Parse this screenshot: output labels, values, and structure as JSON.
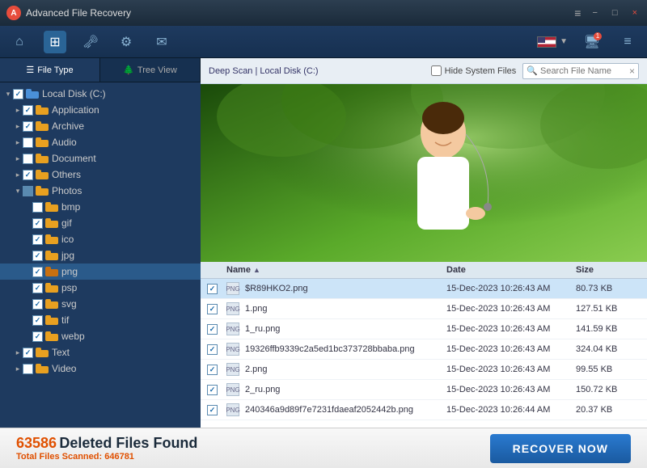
{
  "app": {
    "title": "Advanced File Recovery",
    "logo_letter": "A"
  },
  "toolbar": {
    "buttons": [
      "⌂",
      "⊞",
      "🔑",
      "⚙",
      "✉"
    ],
    "active_index": 1,
    "flag_code": "US",
    "recover_label": "RECOVER NOW"
  },
  "sidebar": {
    "tab_file_type": "File Type",
    "tab_tree_view": "Tree View",
    "active_tab": "file_type",
    "tree": {
      "root": "Local Disk (C:)",
      "items": [
        {
          "id": "application",
          "label": "Application",
          "indent": 1,
          "checked": true,
          "expanded": false
        },
        {
          "id": "archive",
          "label": "Archive",
          "indent": 1,
          "checked": true,
          "expanded": false
        },
        {
          "id": "audio",
          "label": "Audio",
          "indent": 1,
          "checked": false,
          "expanded": false
        },
        {
          "id": "document",
          "label": "Document",
          "indent": 1,
          "checked": false,
          "expanded": false
        },
        {
          "id": "others",
          "label": "Others",
          "indent": 1,
          "checked": true,
          "expanded": false
        },
        {
          "id": "photos",
          "label": "Photos",
          "indent": 1,
          "checked": true,
          "expanded": true
        },
        {
          "id": "bmp",
          "label": "bmp",
          "indent": 2,
          "checked": false,
          "expanded": false
        },
        {
          "id": "gif",
          "label": "gif",
          "indent": 2,
          "checked": true,
          "expanded": false
        },
        {
          "id": "ico",
          "label": "ico",
          "indent": 2,
          "checked": true,
          "expanded": false
        },
        {
          "id": "jpg",
          "label": "jpg",
          "indent": 2,
          "checked": true,
          "expanded": false
        },
        {
          "id": "png",
          "label": "png",
          "indent": 2,
          "checked": true,
          "expanded": false,
          "selected": true
        },
        {
          "id": "psp",
          "label": "psp",
          "indent": 2,
          "checked": true,
          "expanded": false
        },
        {
          "id": "svg",
          "label": "svg",
          "indent": 2,
          "checked": true,
          "expanded": false
        },
        {
          "id": "tif",
          "label": "tif",
          "indent": 2,
          "checked": true,
          "expanded": false
        },
        {
          "id": "webp",
          "label": "webp",
          "indent": 2,
          "checked": true,
          "expanded": false
        },
        {
          "id": "text",
          "label": "Text",
          "indent": 1,
          "checked": true,
          "expanded": false
        },
        {
          "id": "video",
          "label": "Video",
          "indent": 1,
          "checked": false,
          "expanded": false
        }
      ]
    }
  },
  "content": {
    "breadcrumb_scan": "Deep Scan",
    "breadcrumb_sep": "|",
    "breadcrumb_disk": "Local Disk (C:)",
    "hide_system_files_label": "Hide System Files",
    "search_placeholder": "Search File Name",
    "columns": {
      "name": "Name",
      "date": "Date",
      "size": "Size"
    },
    "files": [
      {
        "name": "$R89HKO2.png",
        "date": "15-Dec-2023 10:26:43 AM",
        "size": "80.73 KB",
        "checked": true,
        "selected": true
      },
      {
        "name": "1.png",
        "date": "15-Dec-2023 10:26:43 AM",
        "size": "127.51 KB",
        "checked": true,
        "selected": false
      },
      {
        "name": "1_ru.png",
        "date": "15-Dec-2023 10:26:43 AM",
        "size": "141.59 KB",
        "checked": true,
        "selected": false
      },
      {
        "name": "19326ffb9339c2a5ed1bc373728bbaba.png",
        "date": "15-Dec-2023 10:26:43 AM",
        "size": "324.04 KB",
        "checked": true,
        "selected": false
      },
      {
        "name": "2.png",
        "date": "15-Dec-2023 10:26:43 AM",
        "size": "99.55 KB",
        "checked": true,
        "selected": false
      },
      {
        "name": "2_ru.png",
        "date": "15-Dec-2023 10:26:43 AM",
        "size": "150.72 KB",
        "checked": true,
        "selected": false
      },
      {
        "name": "240346a9d89f7e7231fdaeaf2052442b.png",
        "date": "15-Dec-2023 10:26:44 AM",
        "size": "20.37 KB",
        "checked": true,
        "selected": false
      }
    ]
  },
  "status": {
    "deleted_count": "63586",
    "deleted_label": "Deleted Files Found",
    "total_label": "Total Files Scanned:",
    "total_count": "646781",
    "recover_button": "RECOVER NOW"
  },
  "icons": {
    "home": "⌂",
    "scan": "⊡",
    "key": "🔑",
    "settings": "⚙",
    "email": "✉",
    "menu": "≡",
    "minimize": "−",
    "maximize": "□",
    "close": "×",
    "folder": "📁",
    "file": "📄",
    "search": "🔍"
  }
}
